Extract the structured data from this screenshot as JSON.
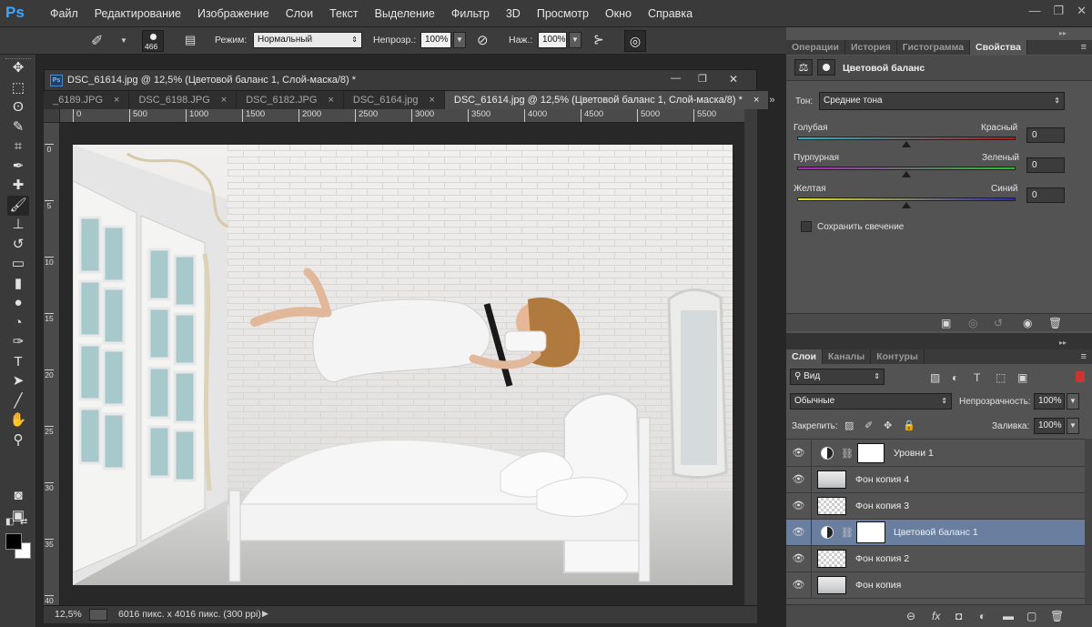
{
  "app": {
    "logo": "Ps"
  },
  "menu": [
    "Файл",
    "Редактирование",
    "Изображение",
    "Слои",
    "Текст",
    "Выделение",
    "Фильтр",
    "3D",
    "Просмотр",
    "Окно",
    "Справка"
  ],
  "window_controls": {
    "minimize": "—",
    "restore": "❐",
    "close": "✕"
  },
  "options_bar": {
    "brush_size": "466",
    "mode_label": "Режим:",
    "mode_value": "Нормальный",
    "opacity_label": "Непрозр.:",
    "opacity_value": "100%",
    "flow_label": "Наж.:",
    "flow_value": "100%"
  },
  "document": {
    "title": "DSC_61614.jpg @ 12,5% (Цветовой баланс 1, Слой-маска/8) *",
    "title_controls": {
      "minimize": "—",
      "restore": "❐",
      "close": "✕"
    },
    "tabs": [
      {
        "label": "_6189.JPG",
        "close": "×"
      },
      {
        "label": "DSC_6198.JPG",
        "close": "×"
      },
      {
        "label": "DSC_6182.JPG",
        "close": "×"
      },
      {
        "label": "DSC_6164.jpg",
        "close": "×"
      },
      {
        "label": "DSC_61614.jpg @ 12,5% (Цветовой баланс 1, Слой-маска/8) *",
        "close": "×",
        "active": true
      }
    ],
    "tab_overflow": "»",
    "ruler_top": [
      "0",
      "500",
      "1000",
      "1500",
      "2000",
      "2500",
      "3000",
      "3500",
      "4000",
      "4500",
      "5000",
      "5500",
      "60"
    ],
    "ruler_left": [
      "0",
      "5",
      "10",
      "15",
      "20",
      "25",
      "30",
      "35",
      "40"
    ],
    "zoom": "12,5%",
    "status_info": "6016 пикс. x 4016 пикс. (300 ppi)",
    "status_arrow": "▶"
  },
  "toolbar": {
    "tools": [
      {
        "name": "move-tool",
        "glyph": "✥"
      },
      {
        "name": "marquee-tool",
        "glyph": "⬚"
      },
      {
        "name": "lasso-tool",
        "glyph": "ʘ"
      },
      {
        "name": "quick-select-tool",
        "glyph": "✎"
      },
      {
        "name": "crop-tool",
        "glyph": "⌗"
      },
      {
        "name": "eyedropper-tool",
        "glyph": "✒"
      },
      {
        "name": "healing-tool",
        "glyph": "✚"
      },
      {
        "name": "brush-tool",
        "glyph": "🖌"
      },
      {
        "name": "stamp-tool",
        "glyph": "⊥"
      },
      {
        "name": "history-brush-tool",
        "glyph": "↺"
      },
      {
        "name": "eraser-tool",
        "glyph": "▭"
      },
      {
        "name": "gradient-tool",
        "glyph": "▮"
      },
      {
        "name": "blur-tool",
        "glyph": "●"
      },
      {
        "name": "dodge-tool",
        "glyph": "◔"
      },
      {
        "name": "pen-tool",
        "glyph": "✑"
      },
      {
        "name": "type-tool",
        "glyph": "T"
      },
      {
        "name": "path-select-tool",
        "glyph": "➤"
      },
      {
        "name": "line-tool",
        "glyph": "╱"
      },
      {
        "name": "hand-tool",
        "glyph": "✋"
      },
      {
        "name": "zoom-tool",
        "glyph": "⚲"
      },
      {
        "name": "quick-mask",
        "glyph": "◙"
      },
      {
        "name": "screen-mode",
        "glyph": "▣"
      }
    ],
    "toggle_colors": "⇄",
    "default_colors": "◧",
    "fg_color": "#000000",
    "bg_color": "#ffffff"
  },
  "properties_panel": {
    "tabs": [
      "Операции",
      "История",
      "Гистограмма",
      "Свойства"
    ],
    "active_tab": "Свойства",
    "title": "Цветовой баланс",
    "tone_label": "Тон:",
    "tone_value": "Средние тона",
    "sliders": [
      {
        "left": "Голубая",
        "right": "Красный",
        "value": "0",
        "gradient": [
          "#21b8c8",
          "#b01818"
        ]
      },
      {
        "left": "Пурпурная",
        "right": "Зеленый",
        "value": "0",
        "gradient": [
          "#b020c0",
          "#28c028"
        ]
      },
      {
        "left": "Желтая",
        "right": "Синий",
        "value": "0",
        "gradient": [
          "#e0e020",
          "#2a2ab0"
        ]
      }
    ],
    "preserve_luminosity": "Сохранить свечение",
    "preserve_checked": false,
    "menu_glyph": "≡",
    "collapse_glyph": "▸▸"
  },
  "layers_panel": {
    "tabs": [
      "Слои",
      "Каналы",
      "Контуры"
    ],
    "active_tab": "Слои",
    "filter_label": "Вид",
    "blend_mode": "Обычные",
    "opacity_label": "Непрозрачность:",
    "opacity_value": "100%",
    "lock_label": "Закрепить:",
    "fill_label": "Заливка:",
    "fill_value": "100%",
    "menu_glyph": "≡",
    "collapse_glyph": "▸▸",
    "layers": [
      {
        "name": "Уровни 1",
        "type": "adjustment",
        "visible": true,
        "selected": false
      },
      {
        "name": "Фон копия 4",
        "type": "image",
        "visible": true,
        "selected": false
      },
      {
        "name": "Фон копия 3",
        "type": "transparent",
        "visible": true,
        "selected": false
      },
      {
        "name": "Цветовой баланс 1",
        "type": "adjustment",
        "visible": true,
        "selected": true
      },
      {
        "name": "Фон копия 2",
        "type": "transparent",
        "visible": true,
        "selected": false
      },
      {
        "name": "Фон копия",
        "type": "image",
        "visible": true,
        "selected": false
      }
    ],
    "footer_icons": [
      "link-icon",
      "fx-icon",
      "mask-icon",
      "adjustment-icon",
      "folder-icon",
      "new-layer-icon",
      "trash-icon"
    ],
    "footer_glyphs": [
      "⊖",
      "fx",
      "◘",
      "◐",
      "▬",
      "▢",
      "🗑"
    ]
  },
  "colors": {
    "ui_dark": "#3a3a3a",
    "panel": "#535353",
    "selection": "#6a7f9f",
    "accent": "#41a5f7"
  }
}
